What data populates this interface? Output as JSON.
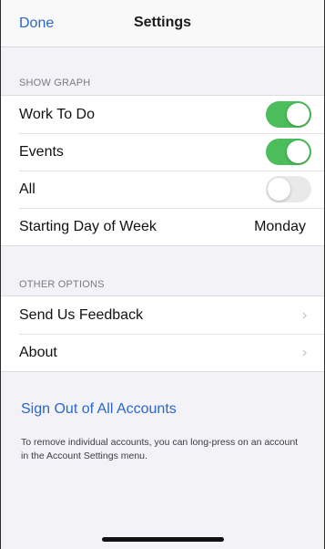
{
  "navbar": {
    "done_label": "Done",
    "title": "Settings"
  },
  "show_graph": {
    "header": "SHOW GRAPH",
    "rows": [
      {
        "label": "Work To Do",
        "toggle": true
      },
      {
        "label": "Events",
        "toggle": true
      },
      {
        "label": "All",
        "toggle": false
      }
    ],
    "starting_day": {
      "label": "Starting Day of Week",
      "value": "Monday"
    }
  },
  "other_options": {
    "header": "OTHER OPTIONS",
    "rows": [
      {
        "label": "Send Us Feedback"
      },
      {
        "label": "About"
      }
    ]
  },
  "sign_out": {
    "label": "Sign Out of All Accounts",
    "note": "To remove individual accounts, you can long-press on an account in the Account Settings menu."
  },
  "colors": {
    "accent": "#2a67c8",
    "toggle_on": "#4bbd5a",
    "toggle_off": "#e9e9ea",
    "background": "#f2f2f7"
  },
  "icons": {
    "chevron": "chevron-right-icon"
  }
}
